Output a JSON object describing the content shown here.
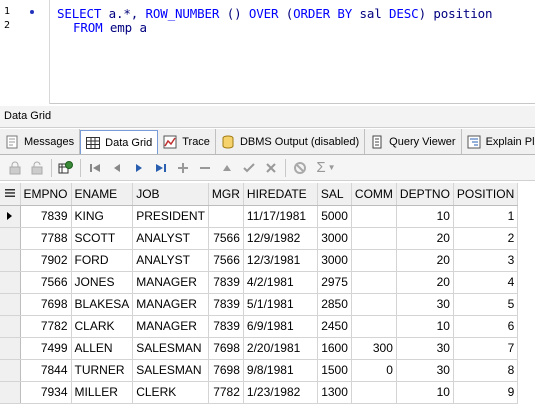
{
  "editor": {
    "line_numbers": [
      "1",
      "2"
    ],
    "line1": {
      "kw1": "SELECT ",
      "id1": "a",
      "t1": ".*, ",
      "kw2": "ROW_NUMBER",
      "t2": " () ",
      "kw3": "OVER",
      "t3": " (",
      "kw4": "ORDER BY",
      "t4": " ",
      "id2": "sal",
      "t5": " ",
      "kw5": "DESC",
      "t6": ") ",
      "id3": "position"
    },
    "line2": {
      "kw1": "FROM",
      "t1": " ",
      "id1": "emp",
      "t2": " ",
      "id2": "a"
    }
  },
  "panel": {
    "title": "Data Grid"
  },
  "tabs": [
    {
      "label": "Messages",
      "icon": "messages-icon"
    },
    {
      "label": "Data Grid",
      "icon": "data-grid-icon",
      "active": true
    },
    {
      "label": "Trace",
      "icon": "trace-icon"
    },
    {
      "label": "DBMS Output (disabled)",
      "icon": "dbms-output-icon"
    },
    {
      "label": "Query Viewer",
      "icon": "query-viewer-icon"
    },
    {
      "label": "Explain Plan",
      "icon": "explain-plan-icon"
    }
  ],
  "toolbar": {
    "buttons": [
      "lock-icon",
      "unlock-icon",
      "refresh-grid-icon",
      "first-record-icon",
      "prior-record-icon",
      "next-record-icon",
      "last-record-icon",
      "insert-record-icon",
      "delete-record-icon",
      "edit-record-icon",
      "post-edit-icon",
      "cancel-edit-icon",
      "refresh-icon",
      "sum-icon"
    ]
  },
  "grid": {
    "columns": [
      "EMPNO",
      "ENAME",
      "JOB",
      "MGR",
      "HIREDATE",
      "SAL",
      "COMM",
      "DEPTNO",
      "POSITION"
    ],
    "rows": [
      [
        "7839",
        "KING",
        "PRESIDENT",
        "",
        "11/17/1981",
        "5000",
        "",
        "10",
        "1"
      ],
      [
        "7788",
        "SCOTT",
        "ANALYST",
        "7566",
        "12/9/1982",
        "3000",
        "",
        "20",
        "2"
      ],
      [
        "7902",
        "FORD",
        "ANALYST",
        "7566",
        "12/3/1981",
        "3000",
        "",
        "20",
        "3"
      ],
      [
        "7566",
        "JONES",
        "MANAGER",
        "7839",
        "4/2/1981",
        "2975",
        "",
        "20",
        "4"
      ],
      [
        "7698",
        "BLAKESA",
        "MANAGER",
        "7839",
        "5/1/1981",
        "2850",
        "",
        "30",
        "5"
      ],
      [
        "7782",
        "CLARK",
        "MANAGER",
        "7839",
        "6/9/1981",
        "2450",
        "",
        "10",
        "6"
      ],
      [
        "7499",
        "ALLEN",
        "SALESMAN",
        "7698",
        "2/20/1981",
        "1600",
        "300",
        "30",
        "7"
      ],
      [
        "7844",
        "TURNER",
        "SALESMAN",
        "7698",
        "9/8/1981",
        "1500",
        "0",
        "30",
        "8"
      ],
      [
        "7934",
        "MILLER",
        "CLERK",
        "7782",
        "1/23/1982",
        "1300",
        "",
        "10",
        "9"
      ]
    ]
  }
}
